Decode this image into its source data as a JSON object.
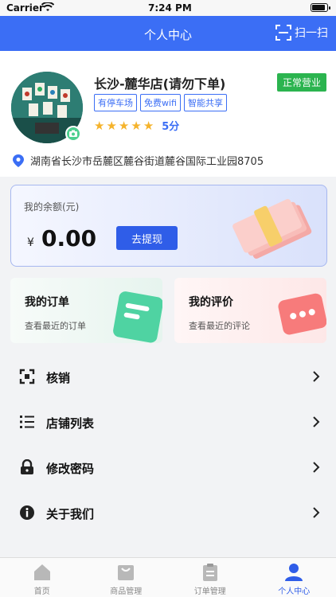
{
  "status_bar": {
    "carrier": "Carrier",
    "time": "7:24 PM"
  },
  "nav": {
    "title": "个人中心",
    "scan_label": "扫一扫"
  },
  "profile": {
    "shop_name": "长沙-麓华店(请勿下单)",
    "status_badge": "正常营业",
    "tags": [
      "有停车场",
      "免费wifi",
      "智能共享"
    ],
    "rating_stars": 5,
    "score": "5分",
    "address": "湖南省长沙市岳麓区麓谷街道麓谷国际工业园8705"
  },
  "balance": {
    "label": "我的余额(元)",
    "currency": "¥",
    "amount": "0.00",
    "withdraw_label": "去提现"
  },
  "cards": {
    "orders": {
      "title": "我的订单",
      "subtitle": "查看最近的订单"
    },
    "reviews": {
      "title": "我的评价",
      "subtitle": "查看最近的评论"
    }
  },
  "menu": [
    {
      "label": "核销",
      "icon": "scan-frame-icon"
    },
    {
      "label": "店铺列表",
      "icon": "list-icon"
    },
    {
      "label": "修改密码",
      "icon": "lock-icon"
    },
    {
      "label": "关于我们",
      "icon": "info-icon"
    }
  ],
  "tabbar": [
    {
      "label": "首页",
      "icon": "home-icon",
      "active": false
    },
    {
      "label": "商品管理",
      "icon": "bag-icon",
      "active": false
    },
    {
      "label": "订单管理",
      "icon": "clipboard-icon",
      "active": false
    },
    {
      "label": "个人中心",
      "icon": "user-icon",
      "active": true
    }
  ],
  "colors": {
    "primary": "#3b6ef5",
    "badge_green": "#2bb44f",
    "star": "#f5b32b"
  }
}
